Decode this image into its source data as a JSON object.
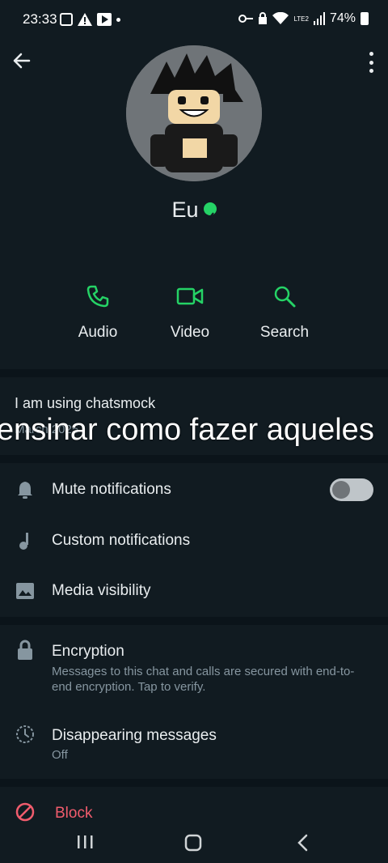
{
  "status_bar": {
    "time": "23:33",
    "battery": "74%",
    "network": "LTE2"
  },
  "profile": {
    "name": "Eu",
    "verified": true
  },
  "actions": [
    {
      "label": "Audio",
      "icon": "phone-icon"
    },
    {
      "label": "Video",
      "icon": "video-icon"
    },
    {
      "label": "Search",
      "icon": "search-icon"
    }
  ],
  "about": {
    "text": "I am using chatsmock",
    "date": "March 2025"
  },
  "overlay_caption": "ensinar como fazer aqueles",
  "settings": {
    "mute": {
      "label": "Mute notifications",
      "enabled": false
    },
    "custom": {
      "label": "Custom notifications"
    },
    "media": {
      "label": "Media visibility"
    },
    "encryption": {
      "label": "Encryption",
      "sub": "Messages to this chat and calls are secured with end-to-end encryption. Tap to verify."
    },
    "disappearing": {
      "label": "Disappearing messages",
      "sub": "Off"
    },
    "block": {
      "label": "Block"
    }
  },
  "colors": {
    "accent": "#25d366",
    "background": "#111b21",
    "danger": "#f15c6d"
  }
}
